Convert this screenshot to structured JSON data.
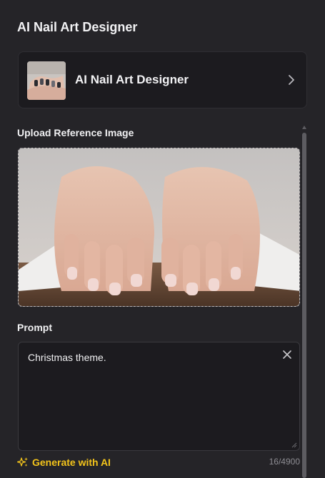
{
  "header": {
    "title": "AI Nail Art Designer"
  },
  "tool_card": {
    "name": "AI Nail Art Designer",
    "thumbnail_icon": "nail-art-thumbnail",
    "chevron_icon": "chevron-right-icon"
  },
  "upload": {
    "label": "Upload Reference Image",
    "image_description_icon": "hands-photo"
  },
  "prompt": {
    "label": "Prompt",
    "value": "Christmas theme.",
    "clear_icon": "close-icon"
  },
  "generate": {
    "label": "Generate with AI",
    "icon": "sparkles-icon",
    "color": "#f2c31b"
  },
  "counter": {
    "text": "16/4900"
  },
  "colors": {
    "background": "#252428",
    "card": "#1c1b1f",
    "accent": "#f2c31b"
  }
}
